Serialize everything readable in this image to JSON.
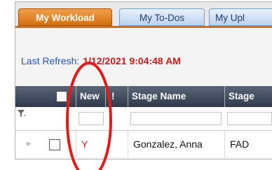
{
  "tabs": [
    {
      "label": "My Workload",
      "active": true
    },
    {
      "label": "My To-Dos",
      "active": false
    },
    {
      "label": "My Upl",
      "active": false
    }
  ],
  "refresh": {
    "label": "Last Refresh:",
    "value": "1/12/2021 9:04:48 AM"
  },
  "grid": {
    "columns": [
      "",
      "New",
      "!",
      "Stage Name",
      "Stage"
    ],
    "rows": [
      {
        "new": "Y",
        "stage_name": "Gonzalez, Anna",
        "stage": "FAD",
        "checked": false
      }
    ]
  },
  "colors": {
    "active_tab": "#d66f0e",
    "header_bg": "#3c4657",
    "refresh_label": "#1f4ed6",
    "refresh_value": "#d01a1a",
    "annotation_ring": "#e31b1b"
  },
  "icons": [
    "filter-funnel-icon",
    "row-expand-arrow-icon",
    "checkbox-icon"
  ]
}
